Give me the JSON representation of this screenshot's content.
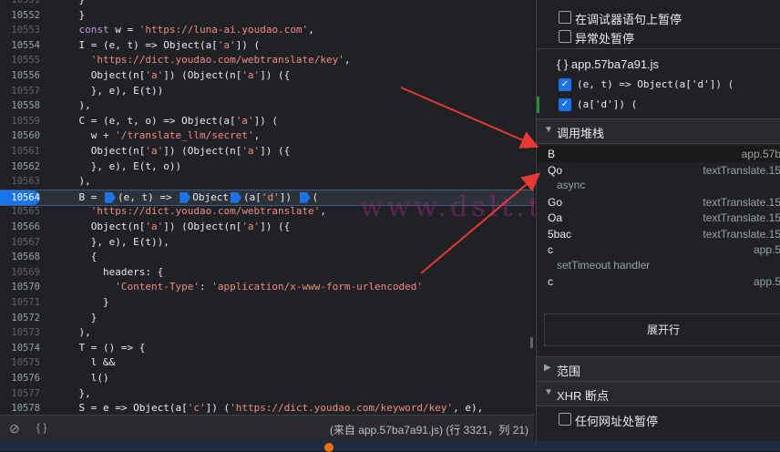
{
  "editor": {
    "lines": [
      {
        "n": "10551",
        "t": "    }"
      },
      {
        "n": "10552",
        "t": "    }"
      },
      {
        "n": "10553",
        "html": "    <span class='kw'>const</span> w = <span class='str'>'https://luna-ai.youdao.com'</span>,"
      },
      {
        "n": "10554",
        "html": "    I = (e, t) => Object(a[<span class='str'>'a'</span>]) ("
      },
      {
        "n": "10555",
        "html": "      <span class='str'>'https://dict.youdao.com/webtranslate/key'</span>,"
      },
      {
        "n": "10556",
        "html": "      Object(n[<span class='str'>'a'</span>]) (Object(n[<span class='str'>'a'</span>]) ({"
      },
      {
        "n": "10557",
        "t": "      }, e), E(t))"
      },
      {
        "n": "10558",
        "t": "    ),"
      },
      {
        "n": "10559",
        "html": "    C = (e, t, o) => Object(a[<span class='str'>'a'</span>]) ("
      },
      {
        "n": "10560",
        "html": "      w + <span class='str'>'/translate_llm/secret'</span>,"
      },
      {
        "n": "10561",
        "html": "      Object(n[<span class='str'>'a'</span>]) (Object(n[<span class='str'>'a'</span>]) ({"
      },
      {
        "n": "10562",
        "t": "      }, e), E(t, o))"
      },
      {
        "n": "10563",
        "t": "    ),"
      },
      {
        "n": "10564",
        "hl": true,
        "html": "    B = <span class='bp'></span>(e, t) => <span class='bp'></span>Object<span class='bp'></span>(a[<span class='str'>'d'</span>]) <span class='bp'></span>("
      },
      {
        "n": "10565",
        "html": "      <span class='str'>'https://dict.youdao.com/webtranslate'</span>,"
      },
      {
        "n": "10566",
        "html": "      Object(n[<span class='str'>'a'</span>]) (Object(n[<span class='str'>'a'</span>]) ({"
      },
      {
        "n": "10567",
        "t": "      }, e), E(t)),"
      },
      {
        "n": "10568",
        "t": "      {"
      },
      {
        "n": "10569",
        "t": "        headers: {"
      },
      {
        "n": "10570",
        "html": "          <span class='str'>'Content-Type'</span>: <span class='str'>'application/x-www-form-urlencoded'</span>"
      },
      {
        "n": "10571",
        "t": "        }"
      },
      {
        "n": "10572",
        "t": "      }"
      },
      {
        "n": "10573",
        "t": "    ),"
      },
      {
        "n": "10574",
        "t": "    T = () => {"
      },
      {
        "n": "10575",
        "t": "      l &&"
      },
      {
        "n": "10576",
        "t": "      l()"
      },
      {
        "n": "10577",
        "t": "    },"
      },
      {
        "n": "10578",
        "html": "    S = e => Object(a[<span class='str'>'c'</span>]) (<span class='str'>'https://dict.youdao.com/keyword/key'</span>, e),"
      }
    ],
    "watermark": "www.dslt.tech"
  },
  "statusbar": {
    "source_text": "(来自 app.57ba7a91.js)  (行 3321，列 21)",
    "braces": "{ }"
  },
  "panel": {
    "pause_debugger": "在调试器语句上暂停",
    "pause_exception": "异常处暂停",
    "file_label": "{ } app.57ba7a91.js",
    "bp1": "(e, t) => Object(a['d']) (",
    "bp2": "(a['d']) (",
    "callstack_title": "调用堆栈",
    "frames": [
      {
        "fn": "B",
        "loc": "app.57b"
      },
      {
        "fn": "Qo",
        "loc": "textTranslate.15"
      },
      {
        "async": "async"
      },
      {
        "fn": "Go",
        "loc": "textTranslate.15"
      },
      {
        "fn": "Oa",
        "loc": "textTranslate.15"
      },
      {
        "fn": "5bac",
        "loc": "textTranslate.15"
      },
      {
        "fn": "c",
        "loc": "app.5"
      },
      {
        "async": "setTimeout handler"
      },
      {
        "fn": "c",
        "loc": "app.5"
      }
    ],
    "expand_label": "展开行",
    "scope_title": "范围",
    "xhr_title": "XHR 断点",
    "any_url": "任何网址处暂停"
  },
  "colors": {
    "accent": "#1a73e8",
    "annotation_arrow": "#e53935"
  }
}
